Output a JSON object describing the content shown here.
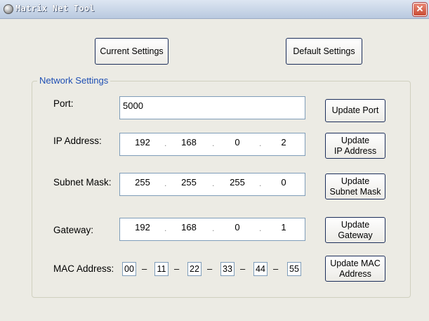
{
  "window": {
    "title": "Matrix Net Tool"
  },
  "toolbar": {
    "current_settings": "Current Settings",
    "default_settings": "Default Settings"
  },
  "group": {
    "label": "Network Settings"
  },
  "port": {
    "label": "Port:",
    "value": "5000",
    "button": "Update Port"
  },
  "ip": {
    "label": "IP Address:",
    "octets": [
      "192",
      "168",
      "0",
      "2"
    ],
    "button": "Update\nIP Address"
  },
  "subnet": {
    "label": "Subnet Mask:",
    "octets": [
      "255",
      "255",
      "255",
      "0"
    ],
    "button": "Update\nSubnet Mask"
  },
  "gateway": {
    "label": "Gateway:",
    "octets": [
      "192",
      "168",
      "0",
      "1"
    ],
    "button": "Update\nGateway"
  },
  "mac": {
    "label": "MAC Address:",
    "bytes": [
      "00",
      "11",
      "22",
      "33",
      "44",
      "55"
    ],
    "separator": "–",
    "button": "Update MAC\nAddress"
  },
  "icons": {
    "app": "app-globe-icon",
    "close": "close-icon"
  }
}
